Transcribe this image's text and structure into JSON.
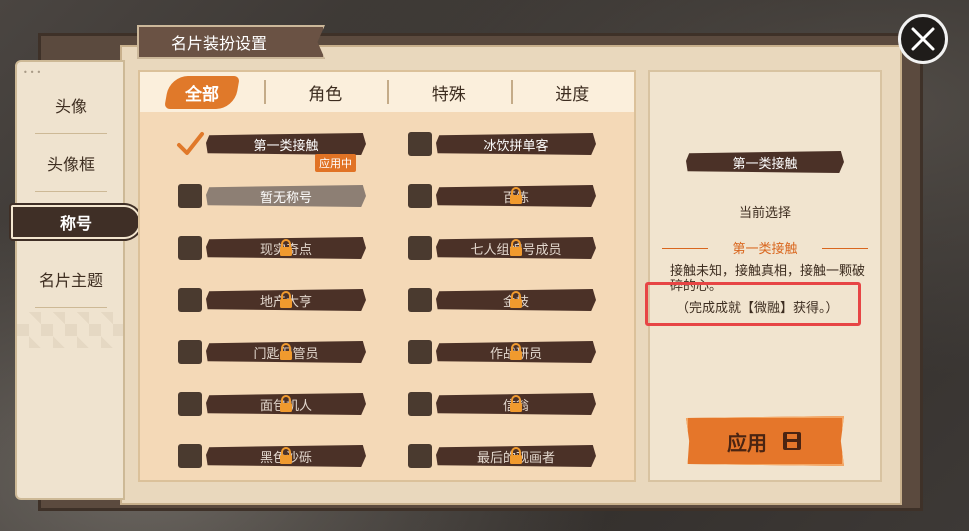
{
  "header": {
    "title": "名片装扮设置"
  },
  "nav": {
    "dots": "•••",
    "items": [
      {
        "label": "头像"
      },
      {
        "label": "头像框"
      },
      {
        "label": "称号",
        "active": true
      },
      {
        "label": "名片主题"
      }
    ]
  },
  "tabs": [
    {
      "label": "全部",
      "active": true
    },
    {
      "label": "角色"
    },
    {
      "label": "特殊"
    },
    {
      "label": "进度"
    }
  ],
  "titles": {
    "left": [
      {
        "label": "第一类接触",
        "checked": true,
        "badge": "应用中"
      },
      {
        "label": "暂无称号",
        "style": "grey"
      },
      {
        "label": "现实奇点",
        "locked": true
      },
      {
        "label": "地产大亨",
        "locked": true
      },
      {
        "label": "门匙保管员",
        "locked": true
      },
      {
        "label": "面包机人",
        "locked": true
      },
      {
        "label": "黑色沙砾",
        "locked": true
      }
    ],
    "right": [
      {
        "label": "冰饮拼单客"
      },
      {
        "label": "百练",
        "locked": true
      },
      {
        "label": "七人组编号成员",
        "locked": true
      },
      {
        "label": "金枝",
        "locked": true
      },
      {
        "label": "作战研员",
        "locked": true
      },
      {
        "label": "信翁",
        "locked": true
      },
      {
        "label": "最后的观画者",
        "locked": true
      }
    ]
  },
  "detail": {
    "title": "第一类接触",
    "current_label": "当前选择",
    "selected_name": "第一类接触",
    "description": "接触未知，接触真相，接触一颗破碎的心。",
    "condition": "（完成成就【微融】获得。）",
    "apply_label": "应用"
  },
  "colors": {
    "accent": "#e5762a",
    "title_bar": "#4b3127",
    "highlight": "#e74545"
  }
}
